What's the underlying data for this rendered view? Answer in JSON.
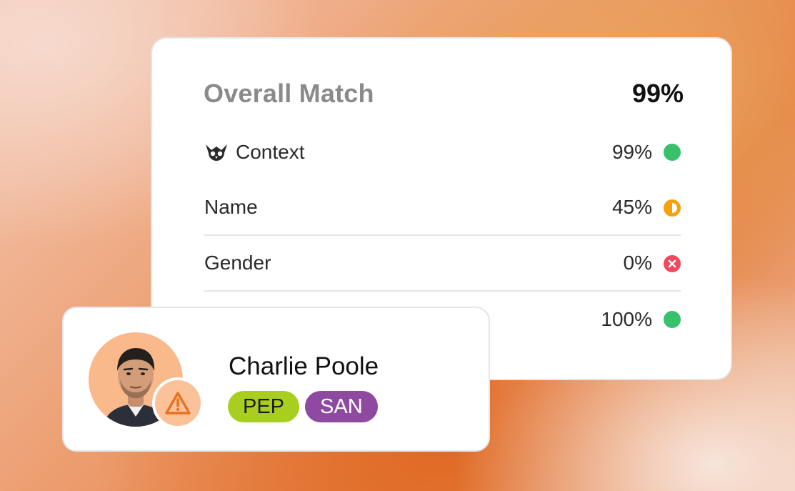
{
  "match": {
    "title": "Overall Match",
    "total": "99%",
    "rows": [
      {
        "label": "Context",
        "value": "99%",
        "status": "match",
        "status_icon": "green-dot-icon",
        "label_icon": "owl-logo-icon"
      },
      {
        "label": "Name",
        "value": "45%",
        "status": "partial",
        "status_icon": "half-circle-icon"
      },
      {
        "label": "Gender",
        "value": "0%",
        "status": "no-match",
        "status_icon": "x-circle-icon"
      },
      {
        "label": "",
        "value": "100%",
        "status": "match",
        "status_icon": "green-dot-icon"
      }
    ]
  },
  "profile": {
    "name": "Charlie Poole",
    "tags": [
      "PEP",
      "SAN"
    ],
    "alert_icon": "warning-triangle-icon"
  },
  "colors": {
    "match": "#36c16a",
    "partial": "#f5a10b",
    "no_match": "#f04a5e",
    "pep_tag": "#a8cf1f",
    "san_tag": "#8e4aa0",
    "avatar_bg": "#f9b98b",
    "warning": "#e8711f"
  }
}
